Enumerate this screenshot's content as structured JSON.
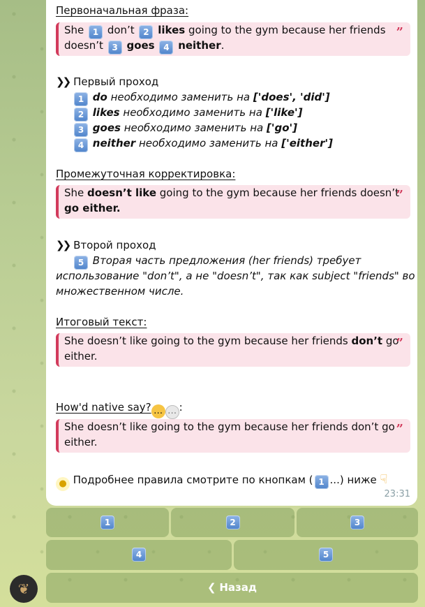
{
  "message": {
    "original": {
      "title": "Первоначальная фраза:",
      "w1": "She",
      "w2": "don’t",
      "w3": "likes",
      "w4": "going to the gym because her friends",
      "w5": "doesn’t",
      "w6": "goes",
      "w7": "neither",
      "w8": "."
    },
    "first_pass": {
      "title": "Первый проход",
      "items": [
        {
          "num": "1",
          "word": "do",
          "text": "необходимо заменить на",
          "value": "['does', 'did']"
        },
        {
          "num": "2",
          "word": "likes",
          "text": "необходимо заменить на",
          "value": "['like']"
        },
        {
          "num": "3",
          "word": "goes",
          "text": "необходимо заменить на",
          "value": "['go']"
        },
        {
          "num": "4",
          "word": "neither",
          "text": "необходимо заменить на",
          "value": "['either']"
        }
      ]
    },
    "intermediate": {
      "title": "Промежуточная корректировка:",
      "w1": "She",
      "w2": "doesn’t like",
      "w3": "going to the gym because her friends doesn’t",
      "w4": "go either."
    },
    "second_pass": {
      "title": "Второй проход",
      "num": "5",
      "line1": "Вторая часть предложения (her friends) требует",
      "line2": "использование \"don’t\", а не \"doesn’t\", так как subject \"friends\" во",
      "line3": "множественном числе."
    },
    "final": {
      "title": "Итоговый текст:",
      "w1": "She doesn’t like going to the gym because her friends",
      "w2": "don’t",
      "w3": "go",
      "w4": "either."
    },
    "native": {
      "title": "How'd native say?",
      "colon": ":",
      "line1": "She doesn’t like going to the gym because her friends don’t go",
      "line2": "either."
    },
    "footer": {
      "text_before": "Подробнее правила смотрите по кнопкам (",
      "badge": "1",
      "text_after": "...) ниже"
    },
    "time": "23:31"
  },
  "quote_icon": "”",
  "keyboard": {
    "row1": [
      "1",
      "2",
      "3"
    ],
    "row2": [
      "4",
      "5"
    ],
    "back": {
      "icon": "❮",
      "label": "Назад"
    }
  },
  "icons": {
    "pass": "pass-arrow-icon",
    "thinking": "thinking-face-icon",
    "speech": "speech-bubble-icon",
    "bulb": "light-bulb-icon",
    "pointing": "pointing-down-icon",
    "avatar": "bot-avatar-icon"
  },
  "colors": {
    "quote_bg": "#fbe3e9",
    "quote_border": "#d23b5c",
    "badge": "#4f84cb",
    "time": "#8ba0a6"
  }
}
